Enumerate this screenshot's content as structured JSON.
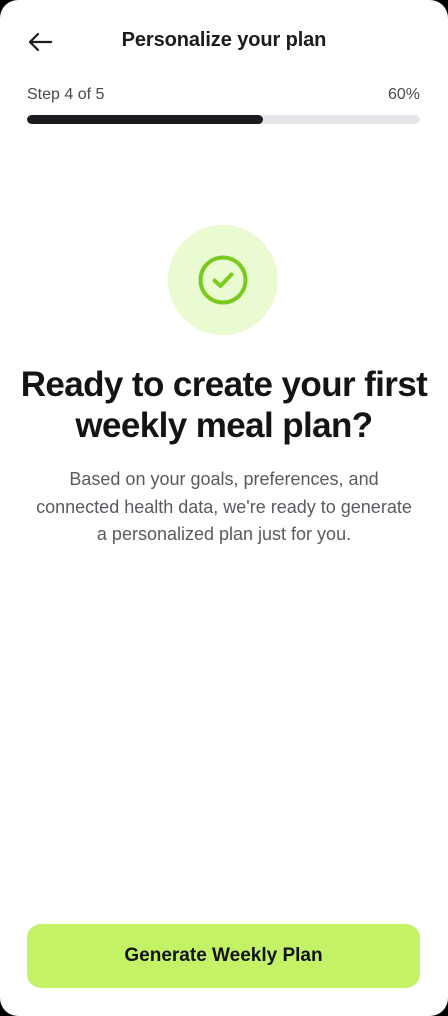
{
  "header": {
    "title": "Personalize your plan",
    "back_icon": "arrow-left-icon"
  },
  "progress": {
    "step_label": "Step 4 of 5",
    "percent_label": "60%",
    "fraction": 0.6
  },
  "success": {
    "icon": "check-circle-icon",
    "accent_color": "#7ac91f",
    "bg_color": "#eafbd2"
  },
  "content": {
    "headline": "Ready to create your first weekly meal plan?",
    "body": "Based on your goals, preferences, and connected health data, we're ready to generate a personalized plan just for you."
  },
  "cta": {
    "label": "Generate Weekly Plan",
    "color": "#c3f266"
  }
}
